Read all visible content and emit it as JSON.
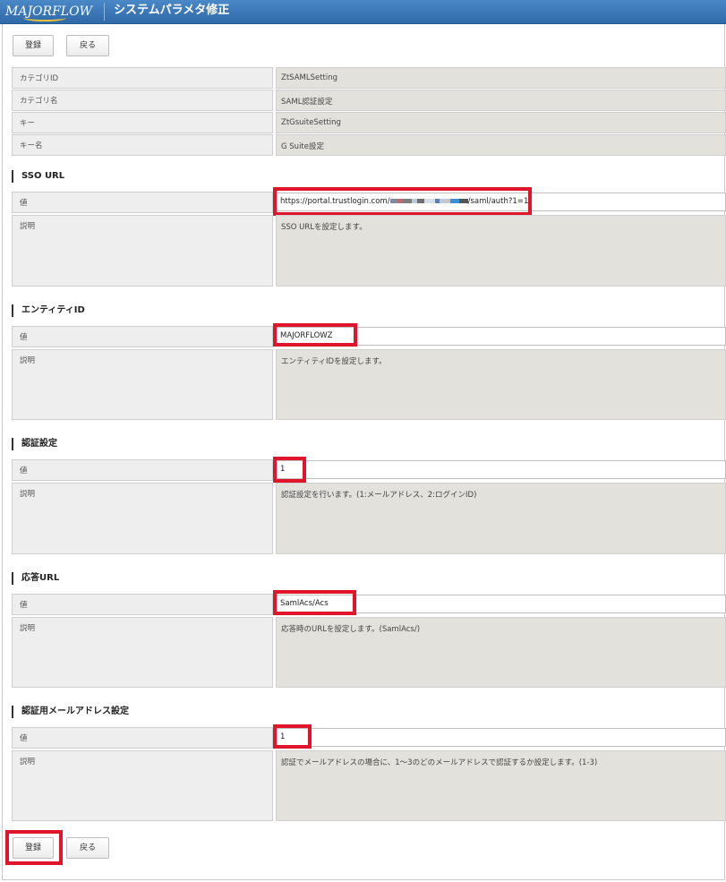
{
  "header": {
    "logo_text": "MAJORFLOW",
    "title": "システムパラメタ修正"
  },
  "toolbar": {
    "register_label": "登録",
    "back_label": "戻る"
  },
  "info_rows": [
    {
      "label": "カテゴリID",
      "value": "ZtSAMLSetting"
    },
    {
      "label": "カテゴリ名",
      "value": "SAML認証設定"
    },
    {
      "label": "キー",
      "value": "ZtGsuiteSetting"
    },
    {
      "label": "キー名",
      "value": " G Suite設定"
    }
  ],
  "sections": [
    {
      "title": "SSO URL",
      "value_label": "値",
      "value_prefix": "https://portal.trustlogin.com/",
      "value_suffix": "/saml/auth?1=1",
      "desc_label": "説明",
      "desc": "SSO URLを設定します。"
    },
    {
      "title": "エンティティID",
      "value_label": "値",
      "value": "MAJORFLOWZ",
      "desc_label": "説明",
      "desc": "エンティティIDを設定します。"
    },
    {
      "title": "認証設定",
      "value_label": "値",
      "value": "1",
      "desc_label": "説明",
      "desc": "認証設定を行います。(1:メールアドレス、2:ログインID)"
    },
    {
      "title": "応答URL",
      "value_label": "値",
      "value": "SamlAcs/Acs",
      "desc_label": "説明",
      "desc": "応答時のURLを設定します。(SamlAcs/)"
    },
    {
      "title": "認証用メールアドレス設定",
      "value_label": "値",
      "value": "1",
      "desc_label": "説明",
      "desc": "認証でメールアドレスの場合に、1～3のどのメールアドレスで認証するか設定します。(1-3)"
    }
  ],
  "colors": {
    "header_bg": "#3a78b9",
    "highlight": "#e0152b",
    "value_bg": "#e2e1dc",
    "label_bg": "#eeeeee"
  }
}
